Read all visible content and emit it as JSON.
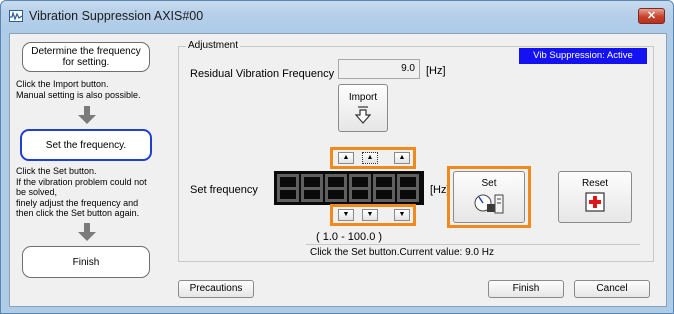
{
  "window": {
    "title": "Vibration Suppression AXIS#00",
    "close_label": "✕"
  },
  "steps": {
    "s1": {
      "label": "Determine the frequency\nfor setting.",
      "note": "Click the Import button.\nManual setting is also possible."
    },
    "s2": {
      "label": "Set the frequency.",
      "note": "Click the Set button.\nIf the vibration problem could not\nbe solved,\nfinely adjust the frequency and\nthen click the Set button again."
    },
    "s3": {
      "label": "Finish"
    }
  },
  "adjustment": {
    "title": "Adjustment",
    "status_badge": "Vib Suppression: Active",
    "residual_label": "Residual Vibration Frequency",
    "residual_value": "9.0",
    "residual_unit": "[Hz]",
    "import_label": "Import",
    "set_freq_label": "Set frequency",
    "set_freq_unit": "[Hz]",
    "range": "( 1.0 - 100.0 )",
    "hint": "Click the Set button.Current value:  9.0 Hz",
    "set_label": "Set",
    "reset_label": "Reset",
    "spin_up": "▲",
    "spin_down": "▼"
  },
  "footer": {
    "precautions": "Precautions",
    "finish": "Finish",
    "cancel": "Cancel"
  },
  "colors": {
    "accent_badge": "#1411f2",
    "highlight": "#f08a1c",
    "active_step": "#1f3fd1"
  }
}
